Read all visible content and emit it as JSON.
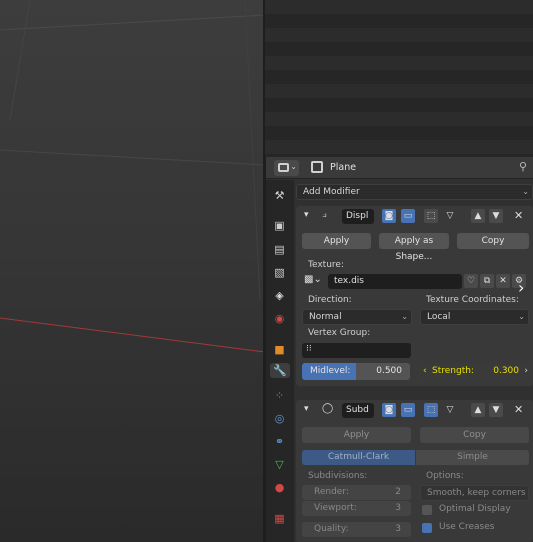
{
  "header": {
    "object_name": "Plane"
  },
  "toolbar": {
    "add_modifier": "Add Modifier"
  },
  "displace": {
    "name": "Displ",
    "apply": "Apply",
    "apply_as_shape": "Apply as Shape...",
    "copy": "Copy",
    "texture_label": "Texture:",
    "texture_name": "tex.dis",
    "direction_label": "Direction:",
    "direction_value": "Normal",
    "tex_coords_label": "Texture Coordinates:",
    "tex_coords_value": "Local",
    "vertex_group_label": "Vertex Group:",
    "midlevel_label": "Midlevel:",
    "midlevel_value": "0.500",
    "strength_label": "Strength:",
    "strength_value": "0.300"
  },
  "subsurf": {
    "name": "Subd",
    "apply": "Apply",
    "copy": "Copy",
    "catmull_clark": "Catmull-Clark",
    "simple": "Simple",
    "subdivisions_label": "Subdivisions:",
    "options_label": "Options:",
    "render_label": "Render:",
    "render_value": "2",
    "viewport_label": "Viewport:",
    "viewport_value": "3",
    "quality_label": "Quality:",
    "quality_value": "3",
    "uv_smooth": "Smooth, keep corners",
    "optimal_display": "Optimal Display",
    "use_creases": "Use Creases"
  },
  "colors": {
    "accent": "#4772b3",
    "highlight": "#e5e000"
  }
}
